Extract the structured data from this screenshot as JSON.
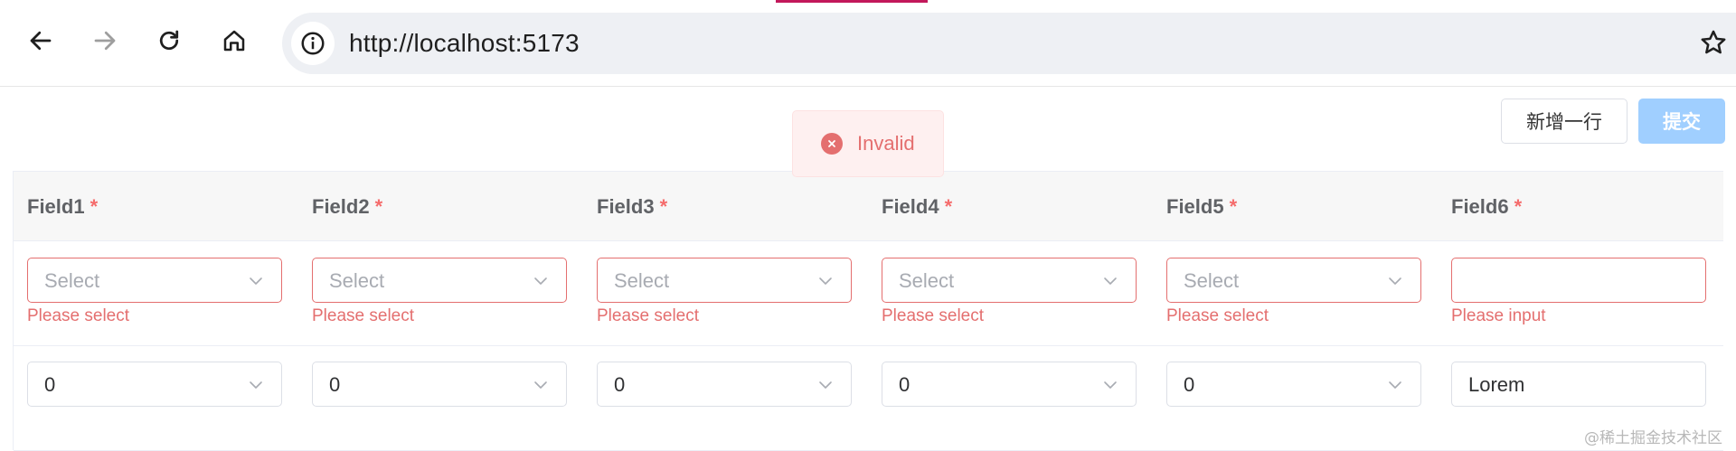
{
  "browser": {
    "url": "http://localhost:5173",
    "icons": [
      "back-icon",
      "forward-icon",
      "reload-icon",
      "home-icon",
      "site-info-icon",
      "bookmark-star-icon"
    ]
  },
  "toolbar": {
    "add_row_label": "新增一行",
    "submit_label": "提交"
  },
  "toast": {
    "message": "Invalid",
    "icon": "error-circle-icon",
    "color": "#e46f6f"
  },
  "table": {
    "columns": [
      {
        "label": "Field1",
        "required_mark": "*"
      },
      {
        "label": "Field2",
        "required_mark": "*"
      },
      {
        "label": "Field3",
        "required_mark": "*"
      },
      {
        "label": "Field4",
        "required_mark": "*"
      },
      {
        "label": "Field5",
        "required_mark": "*"
      },
      {
        "label": "Field6",
        "required_mark": "*"
      }
    ],
    "rows": [
      {
        "cells": [
          {
            "type": "select",
            "placeholder": "Select",
            "value": "",
            "error": "Please select"
          },
          {
            "type": "select",
            "placeholder": "Select",
            "value": "",
            "error": "Please select"
          },
          {
            "type": "select",
            "placeholder": "Select",
            "value": "",
            "error": "Please select"
          },
          {
            "type": "select",
            "placeholder": "Select",
            "value": "",
            "error": "Please select"
          },
          {
            "type": "select",
            "placeholder": "Select",
            "value": "",
            "error": "Please select"
          },
          {
            "type": "input",
            "placeholder": "",
            "value": "",
            "error": "Please input"
          }
        ]
      },
      {
        "cells": [
          {
            "type": "select",
            "value": "0"
          },
          {
            "type": "select",
            "value": "0"
          },
          {
            "type": "select",
            "value": "0"
          },
          {
            "type": "select",
            "value": "0"
          },
          {
            "type": "select",
            "value": "0"
          },
          {
            "type": "input",
            "value": "Lorem"
          }
        ]
      }
    ]
  },
  "watermark": "@稀土掘金技术社区",
  "colors": {
    "error": "#e46f6f",
    "primary_disabled": "#a0cfff",
    "header_bg": "#f7f7f7"
  }
}
